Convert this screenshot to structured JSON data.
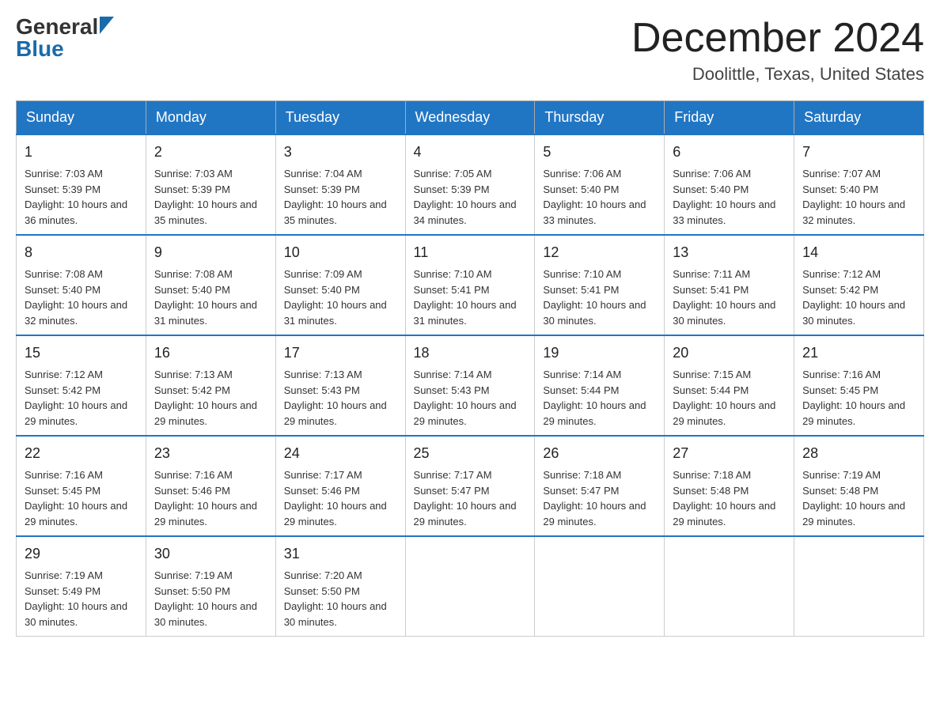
{
  "logo": {
    "general": "General",
    "blue": "Blue"
  },
  "title": {
    "month_year": "December 2024",
    "location": "Doolittle, Texas, United States"
  },
  "days_of_week": [
    "Sunday",
    "Monday",
    "Tuesday",
    "Wednesday",
    "Thursday",
    "Friday",
    "Saturday"
  ],
  "weeks": [
    [
      {
        "date": "1",
        "sunrise": "Sunrise: 7:03 AM",
        "sunset": "Sunset: 5:39 PM",
        "daylight": "Daylight: 10 hours and 36 minutes."
      },
      {
        "date": "2",
        "sunrise": "Sunrise: 7:03 AM",
        "sunset": "Sunset: 5:39 PM",
        "daylight": "Daylight: 10 hours and 35 minutes."
      },
      {
        "date": "3",
        "sunrise": "Sunrise: 7:04 AM",
        "sunset": "Sunset: 5:39 PM",
        "daylight": "Daylight: 10 hours and 35 minutes."
      },
      {
        "date": "4",
        "sunrise": "Sunrise: 7:05 AM",
        "sunset": "Sunset: 5:39 PM",
        "daylight": "Daylight: 10 hours and 34 minutes."
      },
      {
        "date": "5",
        "sunrise": "Sunrise: 7:06 AM",
        "sunset": "Sunset: 5:40 PM",
        "daylight": "Daylight: 10 hours and 33 minutes."
      },
      {
        "date": "6",
        "sunrise": "Sunrise: 7:06 AM",
        "sunset": "Sunset: 5:40 PM",
        "daylight": "Daylight: 10 hours and 33 minutes."
      },
      {
        "date": "7",
        "sunrise": "Sunrise: 7:07 AM",
        "sunset": "Sunset: 5:40 PM",
        "daylight": "Daylight: 10 hours and 32 minutes."
      }
    ],
    [
      {
        "date": "8",
        "sunrise": "Sunrise: 7:08 AM",
        "sunset": "Sunset: 5:40 PM",
        "daylight": "Daylight: 10 hours and 32 minutes."
      },
      {
        "date": "9",
        "sunrise": "Sunrise: 7:08 AM",
        "sunset": "Sunset: 5:40 PM",
        "daylight": "Daylight: 10 hours and 31 minutes."
      },
      {
        "date": "10",
        "sunrise": "Sunrise: 7:09 AM",
        "sunset": "Sunset: 5:40 PM",
        "daylight": "Daylight: 10 hours and 31 minutes."
      },
      {
        "date": "11",
        "sunrise": "Sunrise: 7:10 AM",
        "sunset": "Sunset: 5:41 PM",
        "daylight": "Daylight: 10 hours and 31 minutes."
      },
      {
        "date": "12",
        "sunrise": "Sunrise: 7:10 AM",
        "sunset": "Sunset: 5:41 PM",
        "daylight": "Daylight: 10 hours and 30 minutes."
      },
      {
        "date": "13",
        "sunrise": "Sunrise: 7:11 AM",
        "sunset": "Sunset: 5:41 PM",
        "daylight": "Daylight: 10 hours and 30 minutes."
      },
      {
        "date": "14",
        "sunrise": "Sunrise: 7:12 AM",
        "sunset": "Sunset: 5:42 PM",
        "daylight": "Daylight: 10 hours and 30 minutes."
      }
    ],
    [
      {
        "date": "15",
        "sunrise": "Sunrise: 7:12 AM",
        "sunset": "Sunset: 5:42 PM",
        "daylight": "Daylight: 10 hours and 29 minutes."
      },
      {
        "date": "16",
        "sunrise": "Sunrise: 7:13 AM",
        "sunset": "Sunset: 5:42 PM",
        "daylight": "Daylight: 10 hours and 29 minutes."
      },
      {
        "date": "17",
        "sunrise": "Sunrise: 7:13 AM",
        "sunset": "Sunset: 5:43 PM",
        "daylight": "Daylight: 10 hours and 29 minutes."
      },
      {
        "date": "18",
        "sunrise": "Sunrise: 7:14 AM",
        "sunset": "Sunset: 5:43 PM",
        "daylight": "Daylight: 10 hours and 29 minutes."
      },
      {
        "date": "19",
        "sunrise": "Sunrise: 7:14 AM",
        "sunset": "Sunset: 5:44 PM",
        "daylight": "Daylight: 10 hours and 29 minutes."
      },
      {
        "date": "20",
        "sunrise": "Sunrise: 7:15 AM",
        "sunset": "Sunset: 5:44 PM",
        "daylight": "Daylight: 10 hours and 29 minutes."
      },
      {
        "date": "21",
        "sunrise": "Sunrise: 7:16 AM",
        "sunset": "Sunset: 5:45 PM",
        "daylight": "Daylight: 10 hours and 29 minutes."
      }
    ],
    [
      {
        "date": "22",
        "sunrise": "Sunrise: 7:16 AM",
        "sunset": "Sunset: 5:45 PM",
        "daylight": "Daylight: 10 hours and 29 minutes."
      },
      {
        "date": "23",
        "sunrise": "Sunrise: 7:16 AM",
        "sunset": "Sunset: 5:46 PM",
        "daylight": "Daylight: 10 hours and 29 minutes."
      },
      {
        "date": "24",
        "sunrise": "Sunrise: 7:17 AM",
        "sunset": "Sunset: 5:46 PM",
        "daylight": "Daylight: 10 hours and 29 minutes."
      },
      {
        "date": "25",
        "sunrise": "Sunrise: 7:17 AM",
        "sunset": "Sunset: 5:47 PM",
        "daylight": "Daylight: 10 hours and 29 minutes."
      },
      {
        "date": "26",
        "sunrise": "Sunrise: 7:18 AM",
        "sunset": "Sunset: 5:47 PM",
        "daylight": "Daylight: 10 hours and 29 minutes."
      },
      {
        "date": "27",
        "sunrise": "Sunrise: 7:18 AM",
        "sunset": "Sunset: 5:48 PM",
        "daylight": "Daylight: 10 hours and 29 minutes."
      },
      {
        "date": "28",
        "sunrise": "Sunrise: 7:19 AM",
        "sunset": "Sunset: 5:48 PM",
        "daylight": "Daylight: 10 hours and 29 minutes."
      }
    ],
    [
      {
        "date": "29",
        "sunrise": "Sunrise: 7:19 AM",
        "sunset": "Sunset: 5:49 PM",
        "daylight": "Daylight: 10 hours and 30 minutes."
      },
      {
        "date": "30",
        "sunrise": "Sunrise: 7:19 AM",
        "sunset": "Sunset: 5:50 PM",
        "daylight": "Daylight: 10 hours and 30 minutes."
      },
      {
        "date": "31",
        "sunrise": "Sunrise: 7:20 AM",
        "sunset": "Sunset: 5:50 PM",
        "daylight": "Daylight: 10 hours and 30 minutes."
      },
      null,
      null,
      null,
      null
    ]
  ]
}
